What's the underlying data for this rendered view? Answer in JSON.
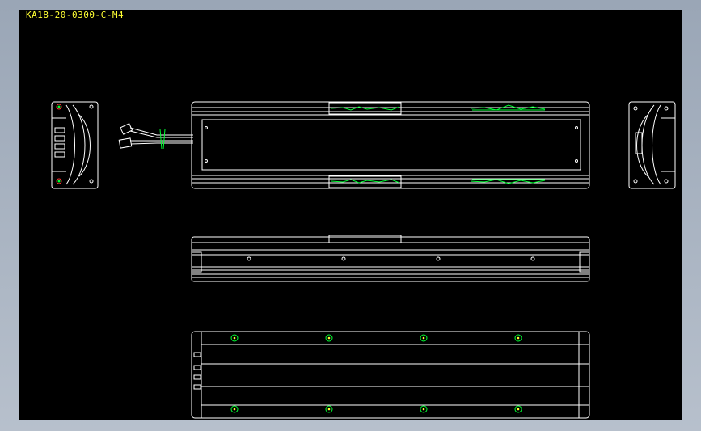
{
  "drawing": {
    "title": "KA18-20-0300-C-M4",
    "background_color": "#000000",
    "line_color": "#ffffff",
    "accent_green": "#00ff33",
    "accent_red": "#ff3333",
    "accent_yellow": "#ffff33"
  },
  "views": [
    {
      "name": "left-end-view"
    },
    {
      "name": "top-view-with-cable"
    },
    {
      "name": "right-end-view"
    },
    {
      "name": "side-view"
    },
    {
      "name": "bottom-view"
    }
  ]
}
